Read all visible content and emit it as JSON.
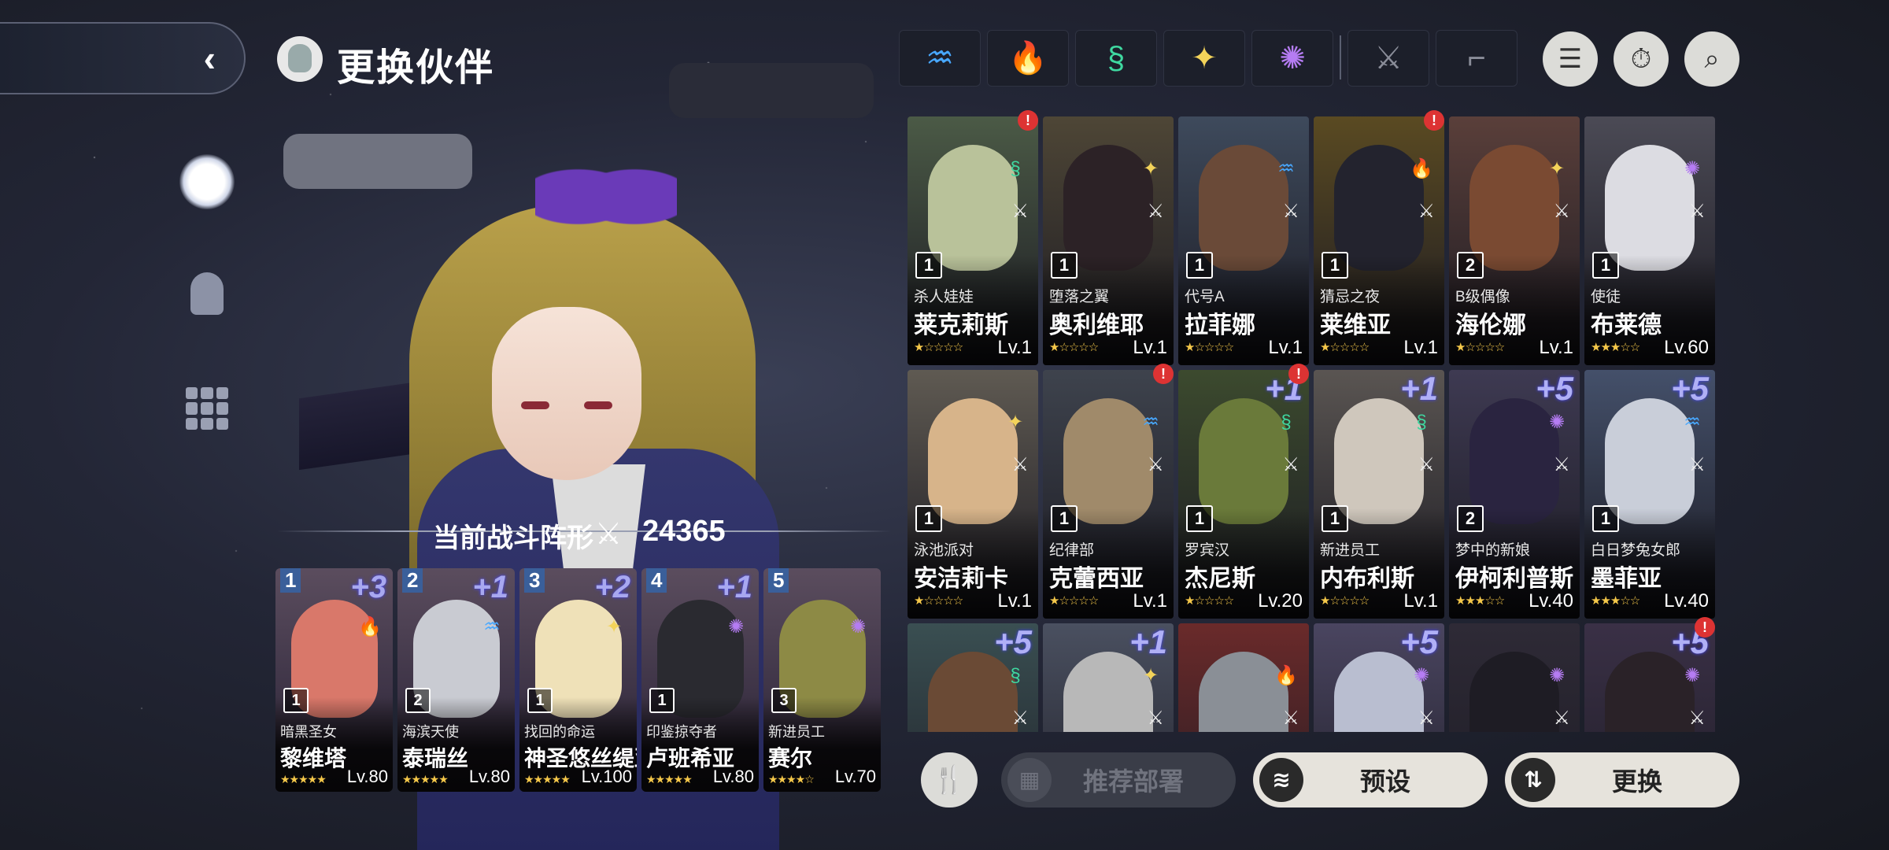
{
  "header": {
    "title": "更换伙伴",
    "back_label": "‹"
  },
  "element_tabs": [
    {
      "id": "water",
      "glyph": "♒",
      "color": "#48a8ff"
    },
    {
      "id": "fire",
      "glyph": "🔥",
      "color": "#ff4a3a"
    },
    {
      "id": "wind",
      "glyph": "§",
      "color": "#3fd8a0"
    },
    {
      "id": "light",
      "glyph": "✦",
      "color": "#f3d35a"
    },
    {
      "id": "dark",
      "glyph": "✺",
      "color": "#b57cf3"
    },
    {
      "id": "sword",
      "glyph": "⚔",
      "color": "#8a8d99"
    },
    {
      "id": "gun",
      "glyph": "⌐",
      "color": "#8a8d99"
    }
  ],
  "toolbar_icons": {
    "filter": "☰",
    "timer": "⏱",
    "search": "⌕"
  },
  "formation": {
    "label": "当前战斗阵形",
    "power": "24365"
  },
  "team": [
    {
      "slot": "1",
      "plus": "+3",
      "tier": "1",
      "subtitle": "暗黑圣女",
      "name": "黎维塔",
      "stars": "★★★★★",
      "level": "Lv.80",
      "element_glyph": "🔥",
      "element_color": "#ff4a3a",
      "portrait_color": "#d9786a"
    },
    {
      "slot": "2",
      "plus": "+1",
      "tier": "2",
      "subtitle": "海滨天使",
      "name": "泰瑞丝",
      "stars": "★★★★★",
      "level": "Lv.80",
      "element_glyph": "♒",
      "element_color": "#48a8ff",
      "portrait_color": "#c9cbd2"
    },
    {
      "slot": "3",
      "plus": "+2",
      "tier": "1",
      "subtitle": "找回的命运",
      "name": "神圣悠丝缇亚",
      "stars": "★★★★★",
      "level": "Lv.100",
      "element_glyph": "✦",
      "element_color": "#f3d35a",
      "portrait_color": "#efe1b8"
    },
    {
      "slot": "4",
      "plus": "+1",
      "tier": "1",
      "subtitle": "印鉴掠夺者",
      "name": "卢班希亚",
      "stars": "★★★★★",
      "level": "Lv.80",
      "element_glyph": "✺",
      "element_color": "#b57cf3",
      "portrait_color": "#2a2a30"
    },
    {
      "slot": "5",
      "plus": "",
      "tier": "3",
      "subtitle": "新进员工",
      "name": "赛尔",
      "stars": "★★★★☆",
      "level": "Lv.70",
      "element_glyph": "✺",
      "element_color": "#b57cf3",
      "portrait_color": "#8d8a45"
    }
  ],
  "roster": [
    {
      "plus": "",
      "tier": "1",
      "subtitle": "杀人娃娃",
      "name": "莱克莉斯",
      "stars": "★☆☆☆☆",
      "level": "Lv.1",
      "element_glyph": "§",
      "element_color": "#3fd8a0",
      "bg": "#4b5a46",
      "portrait_color": "#b9c29a",
      "alert": true
    },
    {
      "plus": "",
      "tier": "1",
      "subtitle": "堕落之翼",
      "name": "奥利维耶",
      "stars": "★☆☆☆☆",
      "level": "Lv.1",
      "element_glyph": "✦",
      "element_color": "#f3d35a",
      "bg": "#4e4636",
      "portrait_color": "#2c2226",
      "alert": false
    },
    {
      "plus": "",
      "tier": "1",
      "subtitle": "代号A",
      "name": "拉菲娜",
      "stars": "★☆☆☆☆",
      "level": "Lv.1",
      "element_glyph": "♒",
      "element_color": "#48a8ff",
      "bg": "#3e4a5c",
      "portrait_color": "#6a4a38",
      "alert": false
    },
    {
      "plus": "",
      "tier": "1",
      "subtitle": "猜忌之夜",
      "name": "莱维亚",
      "stars": "★☆☆☆☆",
      "level": "Lv.1",
      "element_glyph": "🔥",
      "element_color": "#ff4a3a",
      "bg": "#5a4a22",
      "portrait_color": "#23232e",
      "alert": true
    },
    {
      "plus": "",
      "tier": "2",
      "subtitle": "B级偶像",
      "name": "海伦娜",
      "stars": "★☆☆☆☆",
      "level": "Lv.1",
      "element_glyph": "✦",
      "element_color": "#f3d35a",
      "bg": "#5a3f3a",
      "portrait_color": "#7a4a32",
      "alert": false
    },
    {
      "plus": "",
      "tier": "1",
      "subtitle": "使徒",
      "name": "布莱德",
      "stars": "★★★☆☆",
      "level": "Lv.60",
      "element_glyph": "✺",
      "element_color": "#b57cf3",
      "bg": "#4b4a55",
      "portrait_color": "#dcdce2",
      "alert": false
    },
    {
      "plus": "",
      "tier": "1",
      "subtitle": "泳池派对",
      "name": "安洁莉卡",
      "stars": "★☆☆☆☆",
      "level": "Lv.1",
      "element_glyph": "✦",
      "element_color": "#f3d35a",
      "bg": "#5f5a52",
      "portrait_color": "#d7b48a",
      "alert": false
    },
    {
      "plus": "",
      "tier": "1",
      "subtitle": "纪律部",
      "name": "克蕾西亚",
      "stars": "★☆☆☆☆",
      "level": "Lv.1",
      "element_glyph": "♒",
      "element_color": "#48a8ff",
      "bg": "#3e434d",
      "portrait_color": "#a08a6a",
      "alert": true
    },
    {
      "plus": "+1",
      "tier": "1",
      "subtitle": "罗宾汉",
      "name": "杰尼斯",
      "stars": "★☆☆☆☆",
      "level": "Lv.20",
      "element_glyph": "§",
      "element_color": "#3fd8a0",
      "bg": "#3c4a2e",
      "portrait_color": "#6a7a3a",
      "alert": true
    },
    {
      "plus": "+1",
      "tier": "1",
      "subtitle": "新进员工",
      "name": "内布利斯",
      "stars": "★☆☆☆☆",
      "level": "Lv.1",
      "element_glyph": "§",
      "element_color": "#3fd8a0",
      "bg": "#5a5552",
      "portrait_color": "#cfc7bc",
      "alert": false
    },
    {
      "plus": "+5",
      "tier": "2",
      "subtitle": "梦中的新娘",
      "name": "伊柯利普斯",
      "stars": "★★★☆☆",
      "level": "Lv.40",
      "element_glyph": "✺",
      "element_color": "#b57cf3",
      "bg": "#3e3a52",
      "portrait_color": "#2a2440",
      "alert": false
    },
    {
      "plus": "+5",
      "tier": "1",
      "subtitle": "白日梦兔女郎",
      "name": "墨菲亚",
      "stars": "★★★☆☆",
      "level": "Lv.40",
      "element_glyph": "♒",
      "element_color": "#48a8ff",
      "bg": "#44506a",
      "portrait_color": "#c9ced9",
      "alert": false
    },
    {
      "plus": "+5",
      "tier": "",
      "subtitle": "",
      "name": "",
      "stars": "",
      "level": "",
      "element_glyph": "§",
      "element_color": "#3fd8a0",
      "bg": "#3a4f52",
      "portrait_color": "#6a4a35",
      "alert": false
    },
    {
      "plus": "+1",
      "tier": "",
      "subtitle": "",
      "name": "",
      "stars": "",
      "level": "",
      "element_glyph": "✦",
      "element_color": "#f3d35a",
      "bg": "#4a5060",
      "portrait_color": "#b8b8b8",
      "alert": false
    },
    {
      "plus": "",
      "tier": "",
      "subtitle": "",
      "name": "",
      "stars": "",
      "level": "",
      "element_glyph": "🔥",
      "element_color": "#ff4a3a",
      "bg": "#6a2a2a",
      "portrait_color": "#8a8f96",
      "alert": false
    },
    {
      "plus": "+5",
      "tier": "",
      "subtitle": "",
      "name": "",
      "stars": "",
      "level": "",
      "element_glyph": "✺",
      "element_color": "#b57cf3",
      "bg": "#4a4560",
      "portrait_color": "#b9bed0",
      "alert": false
    },
    {
      "plus": "",
      "tier": "",
      "subtitle": "",
      "name": "",
      "stars": "",
      "level": "",
      "element_glyph": "✺",
      "element_color": "#b57cf3",
      "bg": "#2e2a36",
      "portrait_color": "#1e1c24",
      "alert": false
    },
    {
      "plus": "+5",
      "tier": "",
      "subtitle": "",
      "name": "",
      "stars": "",
      "level": "",
      "element_glyph": "✺",
      "element_color": "#b57cf3",
      "bg": "#3a3046",
      "portrait_color": "#2a2228",
      "alert": true
    }
  ],
  "bottom": {
    "food_glyph": "🍴",
    "recommend_label": "推荐部署",
    "preset_label": "预设",
    "swap_label": "更换",
    "recommend_glyph": "▦",
    "preset_glyph": "≋",
    "swap_glyph": "⇅"
  }
}
